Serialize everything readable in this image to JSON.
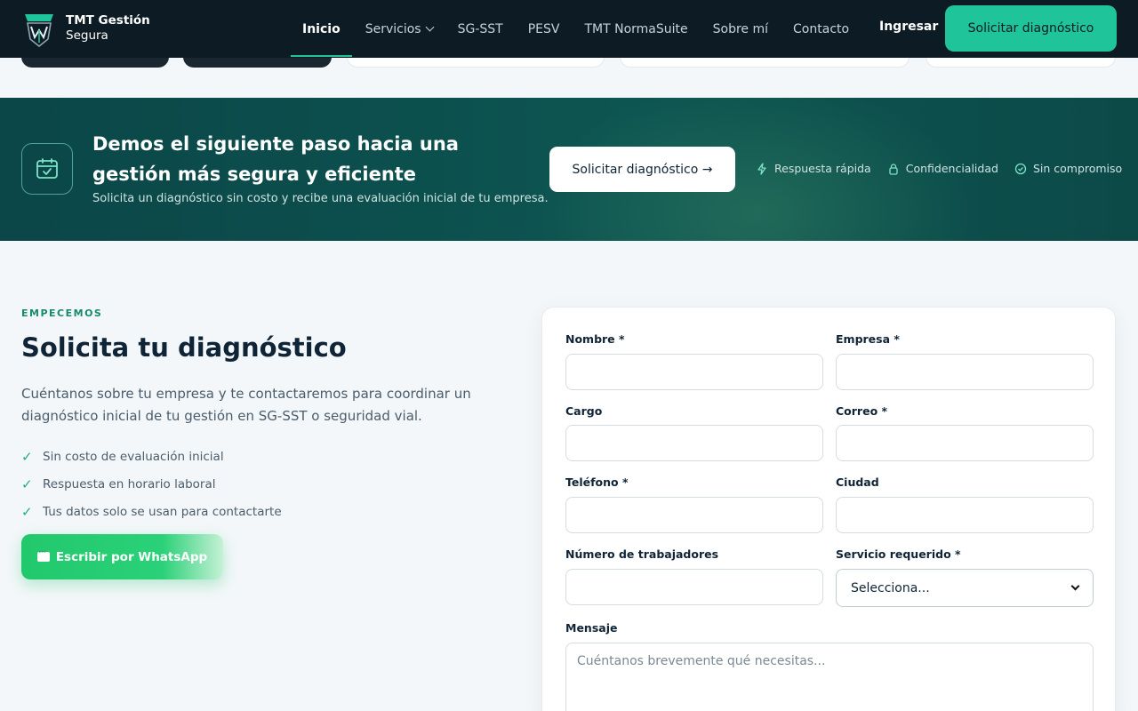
{
  "brand": {
    "line1": "TMT Gestión",
    "line2": "Segura"
  },
  "nav": {
    "items": [
      {
        "label": "Inicio"
      },
      {
        "label": "Servicios"
      },
      {
        "label": "SG-SST"
      },
      {
        "label": "PESV"
      },
      {
        "label": "TMT NormaSuite"
      },
      {
        "label": "Sobre mí"
      },
      {
        "label": "Contacto"
      }
    ],
    "active": "Inicio",
    "login_label": "Ingresar",
    "cta_label": "Solicitar diagnóstico"
  },
  "banner": {
    "title": "Demos el siguiente paso hacia una gestión más segura y eficiente",
    "subtitle": "Solicita un diagnóstico sin costo y recibe una evaluación inicial de tu empresa.",
    "button_label": "Solicitar diagnóstico →",
    "badges": [
      {
        "label": "Respuesta rápida",
        "icon": "bolt-icon"
      },
      {
        "label": "Confidencialidad",
        "icon": "lock-icon"
      },
      {
        "label": "Sin compromiso",
        "icon": "check-circle-icon"
      }
    ]
  },
  "intro": {
    "eyebrow": "EMPECEMOS",
    "title": "Solicita tu diagnóstico",
    "lead": "Cuéntanos sobre tu empresa y te contactaremos para coordinar un diagnóstico inicial de tu gestión en SG-SST o seguridad vial.",
    "checks": [
      "Sin costo de evaluación inicial",
      "Respuesta en horario laboral",
      "Tus datos solo se usan para contactarte"
    ],
    "whatsapp_label": "Escribir por WhatsApp"
  },
  "form": {
    "nombre_label": "Nombre *",
    "empresa_label": "Empresa *",
    "cargo_label": "Cargo",
    "correo_label": "Correo *",
    "telefono_label": "Teléfono *",
    "ciudad_label": "Ciudad",
    "trabajadores_label": "Número de trabajadores",
    "servicio_label": "Servicio requerido *",
    "servicio_value": "Selecciona...",
    "mensaje_label": "Mensaje",
    "mensaje_placeholder": "Cuéntanos brevemente qué necesitas..."
  },
  "colors": {
    "accent": "#1fc49a",
    "header_bg": "#0d1b24",
    "banner_bg": "#0d5551",
    "whatsapp": "#22c86c"
  }
}
